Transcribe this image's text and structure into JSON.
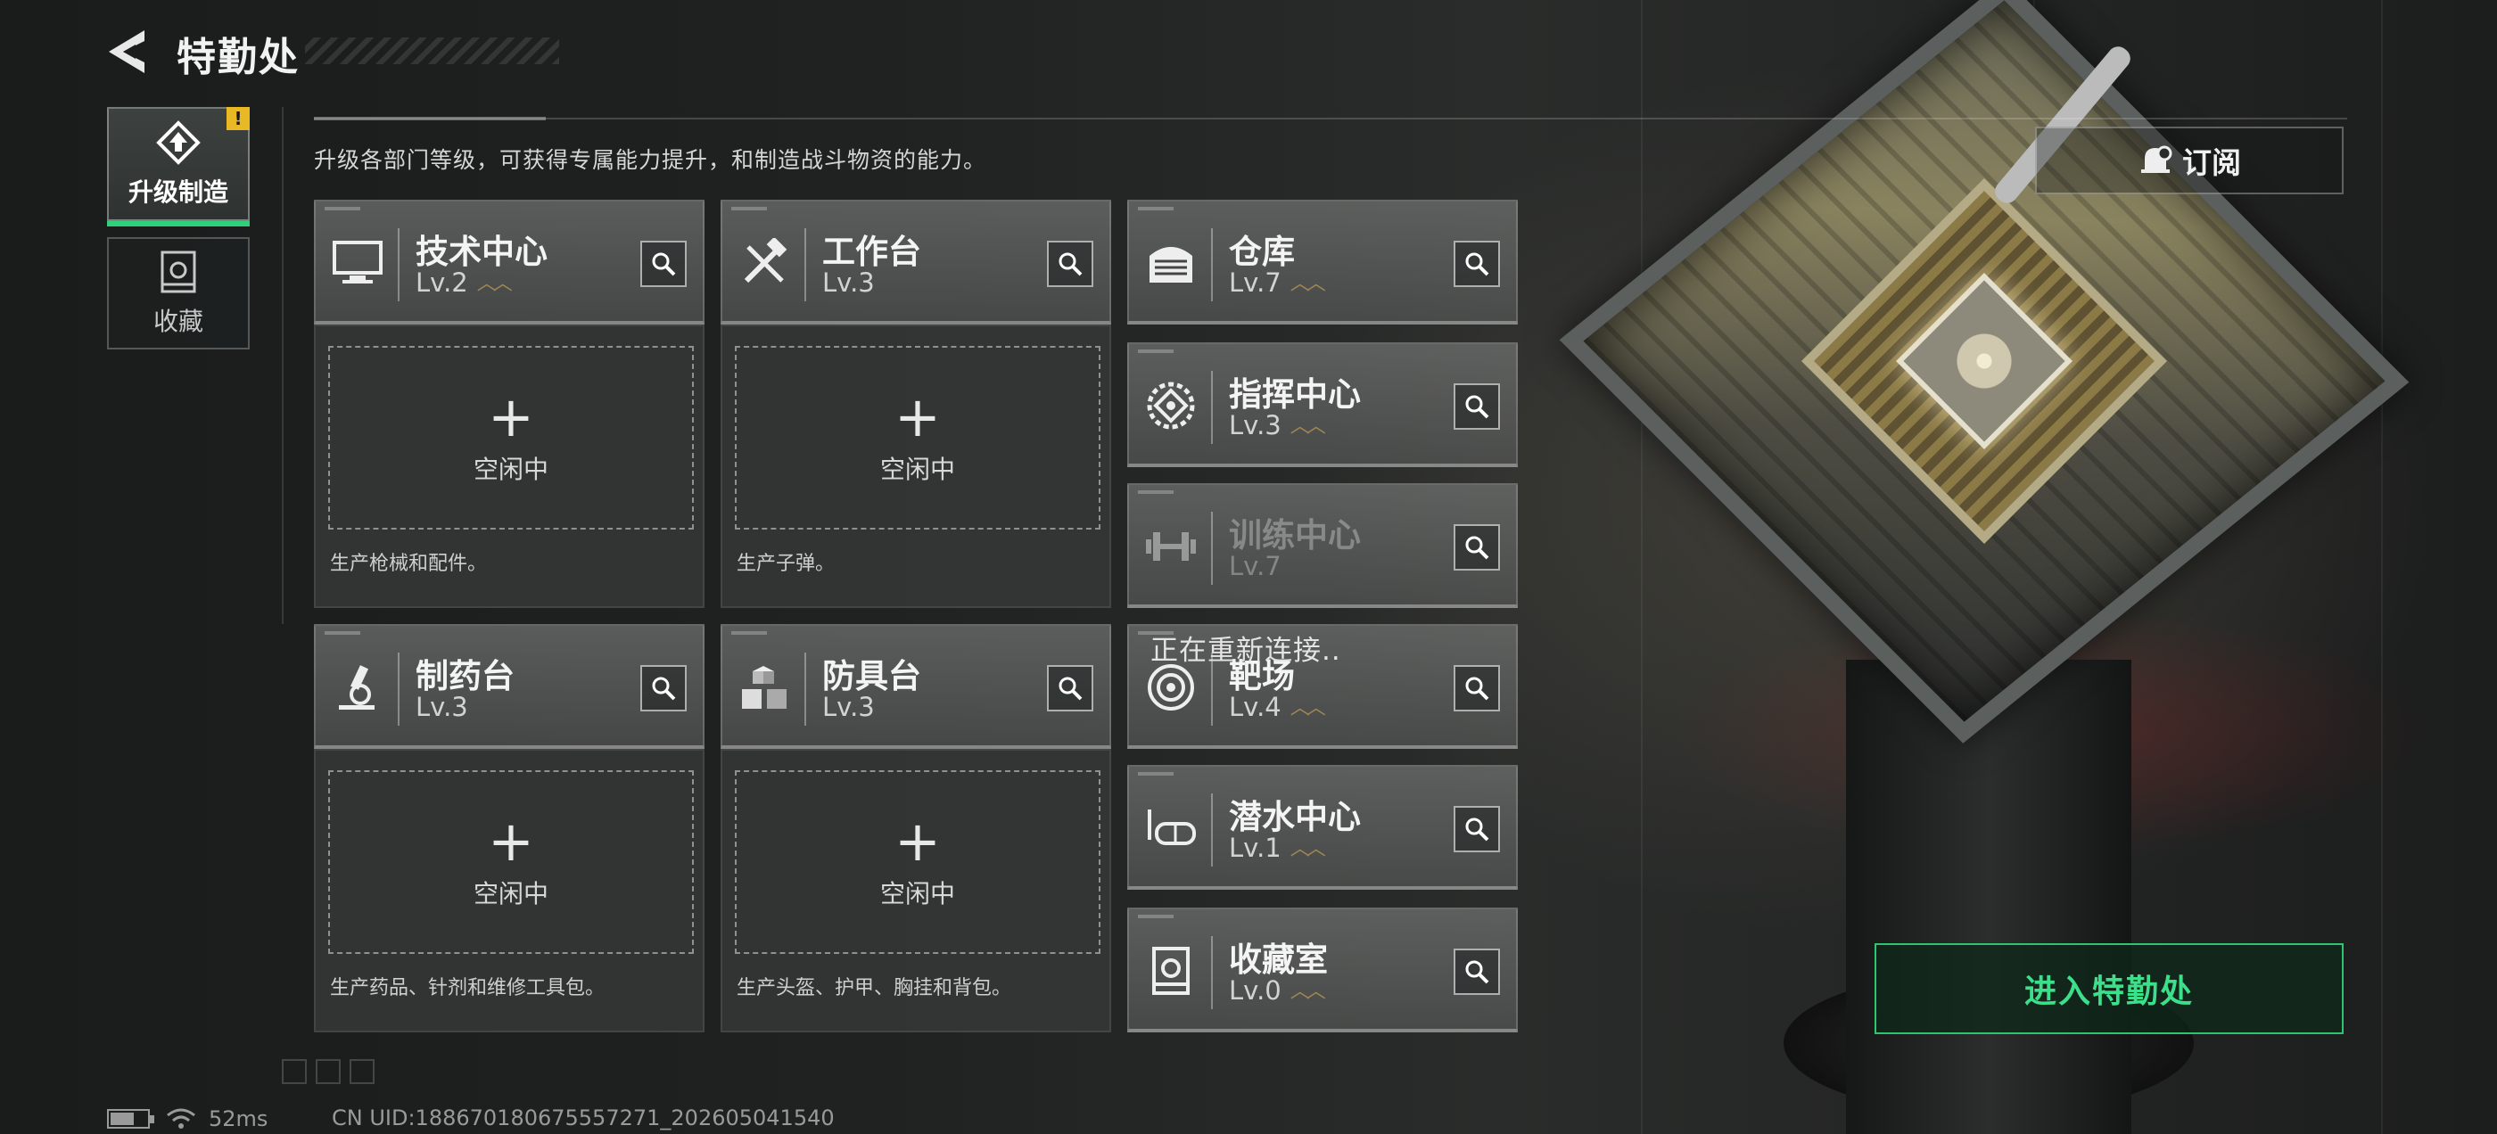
{
  "header": {
    "title": "特勤处"
  },
  "nav": {
    "upgrade_label": "升级制造",
    "upgrade_badge": "!",
    "collection_label": "收藏"
  },
  "description": "升级各部门等级，可获得专属能力提升，和制造战斗物资的能力。",
  "stations": {
    "tech": {
      "name": "技术中心",
      "level": "Lv.2",
      "slot_label": "空闲中",
      "produce": "生产枪械和配件。"
    },
    "workbench": {
      "name": "工作台",
      "level": "Lv.3",
      "slot_label": "空闲中",
      "produce": "生产子弹。"
    },
    "pharmacy": {
      "name": "制药台",
      "level": "Lv.3",
      "slot_label": "空闲中",
      "produce": "生产药品、针剂和维修工具包。"
    },
    "armor": {
      "name": "防具台",
      "level": "Lv.3",
      "slot_label": "空闲中",
      "produce": "生产头盔、护甲、胸挂和背包。"
    },
    "warehouse": {
      "name": "仓库",
      "level": "Lv.7"
    },
    "command": {
      "name": "指挥中心",
      "level": "Lv.3"
    },
    "training": {
      "name": "训练中心",
      "level": "Lv.7"
    },
    "range": {
      "name": "靶场",
      "level": "Lv.4"
    },
    "diving": {
      "name": "潜水中心",
      "level": "Lv.1"
    },
    "collection": {
      "name": "收藏室",
      "level": "Lv.0"
    }
  },
  "plus_glyph": "+",
  "reconnect_text": "正在重新连接..",
  "subscribe_label": "订阅",
  "enter_label": "进入特勤处",
  "status": {
    "ping": "52ms",
    "uid": "CN UID:188670180675557271_202605041540"
  },
  "colors": {
    "accent_green": "#2fd07a",
    "badge_yellow": "#e8b825",
    "level_chevron": "#a08852"
  }
}
